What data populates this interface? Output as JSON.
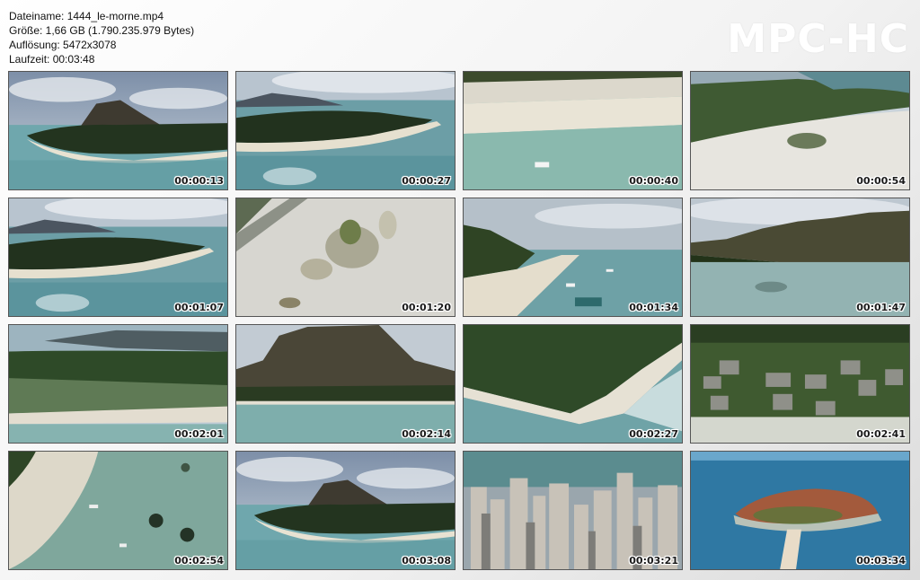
{
  "header": {
    "filename": "Dateiname: 1444_le-morne.mp4",
    "size": "Größe: 1,66 GB (1.790.235.979 Bytes)",
    "resolution": "Auflösung: 5472x3078",
    "duration": "Laufzeit: 00:03:48"
  },
  "logo": "MPC-HC",
  "thumbnails": [
    {
      "time": "00:00:13",
      "scene": "mountain-island"
    },
    {
      "time": "00:00:27",
      "scene": "island-coast"
    },
    {
      "time": "00:00:40",
      "scene": "beach-lagoon-boat"
    },
    {
      "time": "00:00:54",
      "scene": "resort-beach-top"
    },
    {
      "time": "00:01:07",
      "scene": "island-coast"
    },
    {
      "time": "00:01:20",
      "scene": "sandbar-top"
    },
    {
      "time": "00:01:34",
      "scene": "beach-boats"
    },
    {
      "time": "00:01:47",
      "scene": "hills-lagoon"
    },
    {
      "time": "00:02:01",
      "scene": "coast-village"
    },
    {
      "time": "00:02:14",
      "scene": "mountain-closeup"
    },
    {
      "time": "00:02:27",
      "scene": "coast-curve"
    },
    {
      "time": "00:02:41",
      "scene": "resort-villas"
    },
    {
      "time": "00:02:54",
      "scene": "lagoon-top"
    },
    {
      "time": "00:03:08",
      "scene": "mountain-island"
    },
    {
      "time": "00:03:21",
      "scene": "city-skyline"
    },
    {
      "time": "00:03:34",
      "scene": "islet-town"
    }
  ]
}
